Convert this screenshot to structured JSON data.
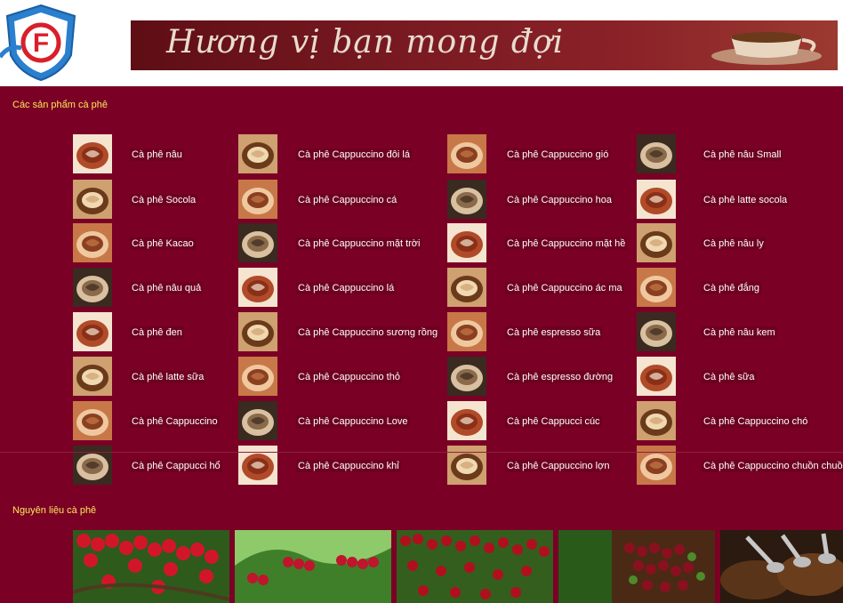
{
  "header": {
    "logo_text": "F",
    "banner_text": "Hương vị bạn mong đợi"
  },
  "sections": {
    "products_title": "Các sản phẩm cà phê",
    "materials_title": "Nguyên liệu cà phê"
  },
  "products": [
    [
      "Cà phê nâu",
      "Cà phê Cappuccino đôi lá",
      "Cà phê Cappuccino gió",
      "Cà phê nâu Small"
    ],
    [
      "Cà phê Socola",
      "Cà phê Cappuccino cá",
      "Cà phê Cappuccino hoa",
      "Cà phê latte socola"
    ],
    [
      "Cà phê Kacao",
      "Cà phê Cappuccino mặt trời",
      "Cà phê Cappuccino mặt hề",
      "Cà phê nâu ly"
    ],
    [
      "Cà phê nâu quả",
      "Cà phê Cappuccino lá",
      "Cà phê Cappuccino ác ma",
      "Cà phê đắng"
    ],
    [
      "Cà phê đen",
      "Cà phê Cappuccino sương rồng",
      "Cà phê espresso sữa",
      "Cà phê nâu kem"
    ],
    [
      "Cà phê latte sữa",
      "Cà phê Cappuccino thỏ",
      "Cà phê espresso đường",
      "Cà phê sữa"
    ],
    [
      "Cà phê Cappuccino",
      "Cà phê Cappuccino Love",
      "Cà phê Cappucci cúc",
      "Cà phê Cappuccino chó"
    ],
    [
      "Cà phê Cappucci hổ",
      "Cà phê Cappuccino khỉ",
      "Cà phê Cappuccino lợn",
      "Cà phê Cappuccino chuồn chuồn"
    ]
  ],
  "colors": {
    "page_bg": "#7a0025",
    "title_yellow": "#ffe75a",
    "label_white": "#ffffff"
  }
}
